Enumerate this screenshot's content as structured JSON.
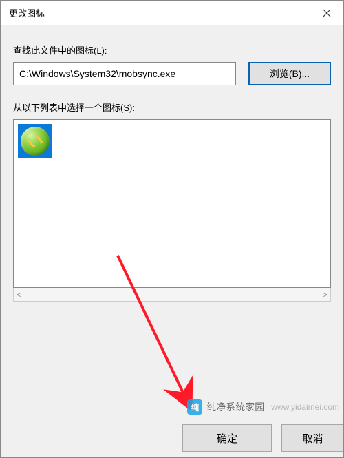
{
  "window": {
    "title": "更改图标"
  },
  "labels": {
    "lookForIcons": "查找此文件中的图标(L):",
    "selectIcon": "从以下列表中选择一个图标(S):"
  },
  "path": {
    "value": "C:\\Windows\\System32\\mobsync.exe"
  },
  "buttons": {
    "browse": "浏览(B)...",
    "ok": "确定",
    "cancel": "取消"
  },
  "icons": {
    "items": [
      {
        "name": "sync-icon"
      }
    ]
  },
  "scroll": {
    "left": "<",
    "right": ">"
  },
  "watermark": {
    "cn": "纯净系统家园",
    "url": "www.yidaimei.com",
    "logoLetter": "纯"
  }
}
